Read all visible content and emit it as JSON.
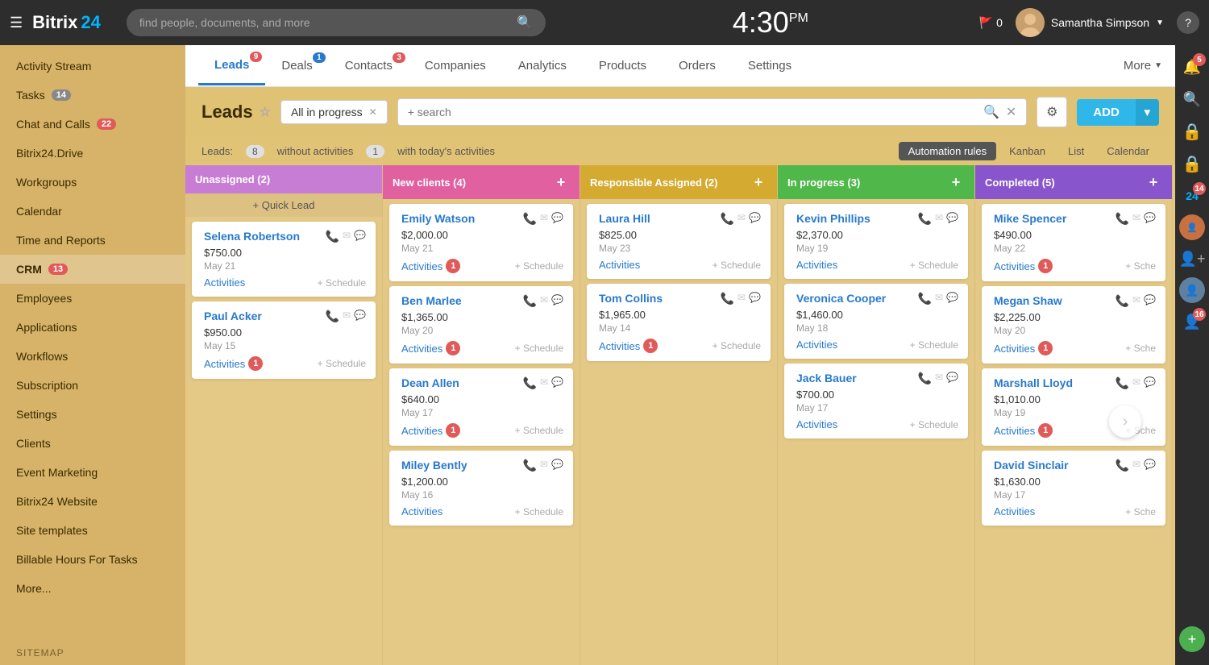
{
  "header": {
    "menu_icon": "☰",
    "logo_bitrix": "Bitrix",
    "logo_24": "24",
    "search_placeholder": "find people, documents, and more",
    "clock": "4:30",
    "clock_suffix": "PM",
    "flag_count": "0",
    "username": "Samantha Simpson",
    "help": "?"
  },
  "sidebar": {
    "items": [
      {
        "id": "activity-stream",
        "label": "Activity Stream",
        "badge": null
      },
      {
        "id": "tasks",
        "label": "Tasks",
        "badge": "14",
        "badge_type": "grey"
      },
      {
        "id": "chat-calls",
        "label": "Chat and Calls",
        "badge": "22",
        "badge_type": "red"
      },
      {
        "id": "bitrix24-drive",
        "label": "Bitrix24.Drive",
        "badge": null
      },
      {
        "id": "workgroups",
        "label": "Workgroups",
        "badge": null
      },
      {
        "id": "calendar",
        "label": "Calendar",
        "badge": null
      },
      {
        "id": "time-reports",
        "label": "Time and Reports",
        "badge": null
      },
      {
        "id": "crm",
        "label": "CRM",
        "badge": "13",
        "badge_type": "red"
      },
      {
        "id": "employees",
        "label": "Employees",
        "badge": null
      },
      {
        "id": "applications",
        "label": "Applications",
        "badge": null
      },
      {
        "id": "workflows",
        "label": "Workflows",
        "badge": null
      },
      {
        "id": "subscription",
        "label": "Subscription",
        "badge": null
      },
      {
        "id": "settings",
        "label": "Settings",
        "badge": null
      },
      {
        "id": "clients",
        "label": "Clients",
        "badge": null
      },
      {
        "id": "event-marketing",
        "label": "Event Marketing",
        "badge": null
      },
      {
        "id": "bitrix24-website",
        "label": "Bitrix24 Website",
        "badge": null
      },
      {
        "id": "site-templates",
        "label": "Site templates",
        "badge": null
      },
      {
        "id": "billable-hours",
        "label": "Billable Hours For Tasks",
        "badge": null
      },
      {
        "id": "more",
        "label": "More...",
        "badge": null
      }
    ],
    "sitemap": "SITEMAP"
  },
  "crm_tabs": [
    {
      "id": "leads",
      "label": "Leads",
      "badge": "9",
      "badge_type": "red",
      "active": true
    },
    {
      "id": "deals",
      "label": "Deals",
      "badge": "1",
      "badge_type": "blue",
      "active": false
    },
    {
      "id": "contacts",
      "label": "Contacts",
      "badge": "3",
      "badge_type": "red",
      "active": false
    },
    {
      "id": "companies",
      "label": "Companies",
      "badge": null,
      "active": false
    },
    {
      "id": "analytics",
      "label": "Analytics",
      "badge": null,
      "active": false
    },
    {
      "id": "products",
      "label": "Products",
      "badge": null,
      "active": false
    },
    {
      "id": "orders",
      "label": "Orders",
      "badge": null,
      "active": false
    },
    {
      "id": "settings-tab",
      "label": "Settings",
      "badge": null,
      "active": false
    }
  ],
  "more_label": "More",
  "leads_header": {
    "title": "Leads",
    "filter_tag": "All in progress",
    "search_placeholder": "+ search",
    "add_label": "ADD"
  },
  "leads_subheader": {
    "prefix": "Leads:",
    "without_activities_count": "8",
    "without_activities_label": "without activities",
    "with_activities_count": "1",
    "with_activities_label": "with today's activities"
  },
  "view_buttons": [
    {
      "id": "automation",
      "label": "Automation rules",
      "active": true
    },
    {
      "id": "kanban",
      "label": "Kanban",
      "active": false
    },
    {
      "id": "list",
      "label": "List",
      "active": false
    },
    {
      "id": "calendar",
      "label": "Calendar",
      "active": false
    }
  ],
  "kanban_columns": [
    {
      "id": "unassigned",
      "label": "Unassigned",
      "count": 2,
      "color_class": "unassigned",
      "show_quick_lead": true,
      "cards": [
        {
          "name": "Selena Robertson",
          "amount": "$750.00",
          "date": "May 21",
          "has_phone": false,
          "activities_label": "Activities",
          "activities_badge": null,
          "schedule_label": "+ Schedule"
        },
        {
          "name": "Paul Acker",
          "amount": "$950.00",
          "date": "May 15",
          "has_phone": true,
          "activities_label": "Activities",
          "activities_badge": "1",
          "schedule_label": "+ Schedule"
        }
      ]
    },
    {
      "id": "new-clients",
      "label": "New clients",
      "count": 4,
      "color_class": "new-clients",
      "show_quick_lead": false,
      "cards": [
        {
          "name": "Emily Watson",
          "amount": "$2,000.00",
          "date": "May 21",
          "has_phone": false,
          "activities_label": "Activities",
          "activities_badge": "1",
          "schedule_label": "+ Schedule"
        },
        {
          "name": "Ben Marlee",
          "amount": "$1,365.00",
          "date": "May 20",
          "has_phone": false,
          "activities_label": "Activities",
          "activities_badge": "1",
          "schedule_label": "+ Schedule"
        },
        {
          "name": "Dean Allen",
          "amount": "$640.00",
          "date": "May 17",
          "has_phone": false,
          "activities_label": "Activities",
          "activities_badge": "1",
          "schedule_label": "+ Schedule"
        },
        {
          "name": "Miley Bently",
          "amount": "$1,200.00",
          "date": "May 16",
          "has_phone": true,
          "activities_label": "Activities",
          "activities_badge": null,
          "schedule_label": "+ Schedule"
        }
      ]
    },
    {
      "id": "responsible",
      "label": "Responsible Assigned",
      "count": 2,
      "color_class": "responsible",
      "show_quick_lead": false,
      "cards": [
        {
          "name": "Laura Hill",
          "amount": "$825.00",
          "date": "May 23",
          "has_phone": true,
          "activities_label": "Activities",
          "activities_badge": null,
          "schedule_label": "+ Schedule"
        },
        {
          "name": "Tom Collins",
          "amount": "$1,965.00",
          "date": "May 14",
          "has_phone": false,
          "activities_label": "Activities",
          "activities_badge": "1",
          "schedule_label": "+ Schedule"
        }
      ]
    },
    {
      "id": "in-progress",
      "label": "In progress",
      "count": 3,
      "color_class": "in-progress",
      "show_quick_lead": false,
      "cards": [
        {
          "name": "Kevin Phillips",
          "amount": "$2,370.00",
          "date": "May 19",
          "has_phone": false,
          "activities_label": "Activities",
          "activities_badge": null,
          "schedule_label": "+ Schedule"
        },
        {
          "name": "Veronica Cooper",
          "amount": "$1,460.00",
          "date": "May 18",
          "has_phone": false,
          "activities_label": "Activities",
          "activities_badge": null,
          "schedule_label": "+ Schedule"
        },
        {
          "name": "Jack Bauer",
          "amount": "$700.00",
          "date": "May 17",
          "has_phone": true,
          "activities_label": "Activities",
          "activities_badge": null,
          "schedule_label": "+ Schedule"
        }
      ]
    },
    {
      "id": "completed",
      "label": "Completed",
      "count": 5,
      "color_class": "completed",
      "show_quick_lead": false,
      "cards": [
        {
          "name": "Mike Spencer",
          "amount": "$490.00",
          "date": "May 22",
          "has_phone": false,
          "activities_label": "Activities",
          "activities_badge": "1",
          "schedule_label": "+ Sche"
        },
        {
          "name": "Megan Shaw",
          "amount": "$2,225.00",
          "date": "May 20",
          "has_phone": false,
          "activities_label": "Activities",
          "activities_badge": "1",
          "schedule_label": "+ Sche"
        },
        {
          "name": "Marshall Lloyd",
          "amount": "$1,010.00",
          "date": "May 19",
          "has_phone": false,
          "activities_label": "Activities",
          "activities_badge": "1",
          "schedule_label": "+ Sche"
        },
        {
          "name": "David Sinclair",
          "amount": "$1,630.00",
          "date": "May 17",
          "has_phone": false,
          "activities_label": "Activities",
          "activities_badge": null,
          "schedule_label": "+ Sche"
        }
      ]
    }
  ],
  "right_panel": {
    "bell_badge": "5",
    "bitrix24_badge": "14",
    "user_badge": "16"
  }
}
